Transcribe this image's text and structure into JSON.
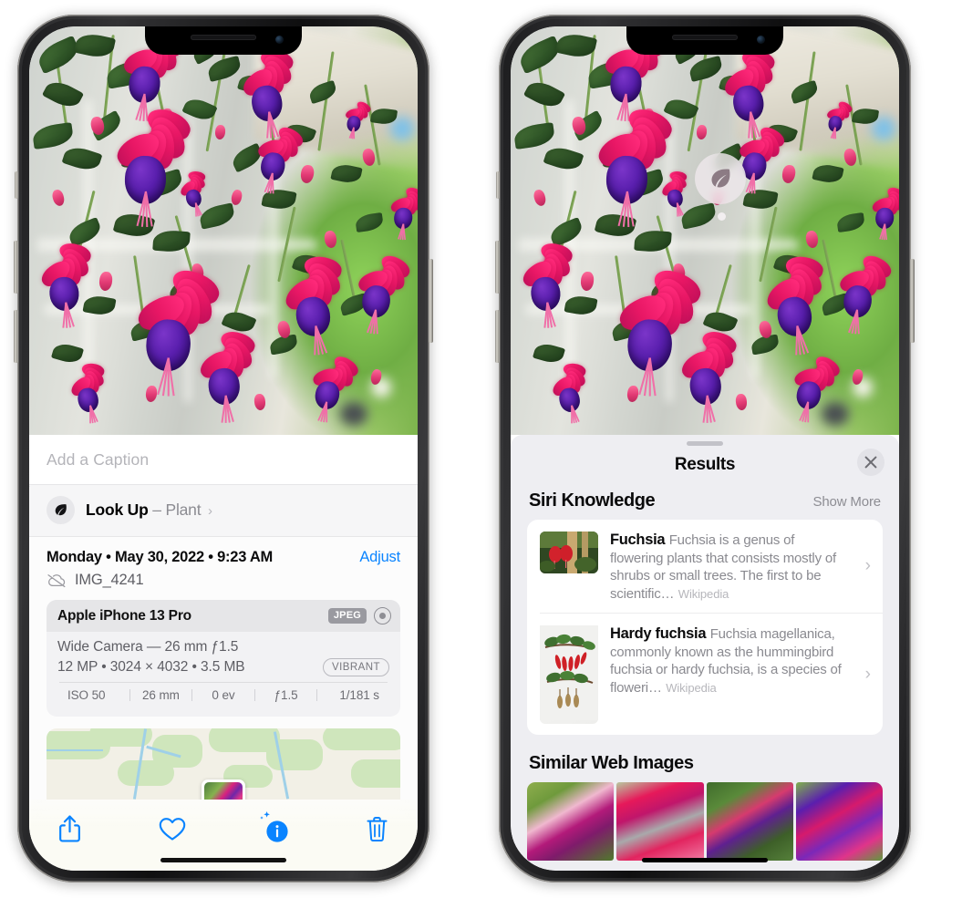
{
  "left_phone": {
    "name": "photos-detail-screen",
    "caption": {
      "placeholder": "Add a Caption",
      "value": ""
    },
    "lookup": {
      "icon": "leaf-icon",
      "label": "Look Up",
      "dash": "–",
      "subject": "Plant",
      "chevron": "›"
    },
    "meta": {
      "date": "Monday • May 30, 2022 • 9:23 AM",
      "adjust_label": "Adjust",
      "cloud_icon": "cloud-slash-icon",
      "filename": "IMG_4241"
    },
    "exif": {
      "model": "Apple iPhone 13 Pro",
      "format_tag": "JPEG",
      "raw_icon": "raw-ring-icon",
      "lens_line": "Wide Camera — 26 mm ƒ1.5",
      "size_line": "12 MP • 3024 × 4032 • 3.5 MB",
      "style_tag": "VIBRANT",
      "stats": [
        "ISO 50",
        "26 mm",
        "0 ev",
        "ƒ1.5",
        "1/181 s"
      ]
    },
    "toolbar": [
      {
        "name": "share-button",
        "icon": "share-icon"
      },
      {
        "name": "favorite-button",
        "icon": "heart-icon"
      },
      {
        "name": "info-button",
        "icon": "info-sparkle-icon"
      },
      {
        "name": "delete-button",
        "icon": "trash-icon"
      }
    ]
  },
  "right_phone": {
    "name": "visual-lookup-results-screen",
    "lens_badge": {
      "icon": "leaf-icon"
    },
    "panel": {
      "grabber": "drag-handle",
      "title": "Results",
      "close_icon": "close-icon"
    },
    "siri_knowledge": {
      "title": "Siri Knowledge",
      "show_more": "Show More",
      "items": [
        {
          "title": "Fuchsia",
          "description": "Fuchsia is a genus of flowering plants that consists mostly of shrubs or small trees. The first to be scientific…",
          "source": "Wikipedia",
          "chevron": "›"
        },
        {
          "title": "Hardy fuchsia",
          "description": "Fuchsia magellanica, commonly known as the hummingbird fuchsia or hardy fuchsia, is a species of floweri…",
          "source": "Wikipedia",
          "chevron": "›"
        }
      ]
    },
    "similar_web_images": {
      "title": "Similar Web Images",
      "count": 4
    }
  },
  "colors": {
    "accent_blue": "#0a84ff",
    "panel_bg": "#eeeef2",
    "card_bg": "#ffffff",
    "secondary_text": "#8a8a90",
    "sheet_bg": "#fcfcfc"
  }
}
